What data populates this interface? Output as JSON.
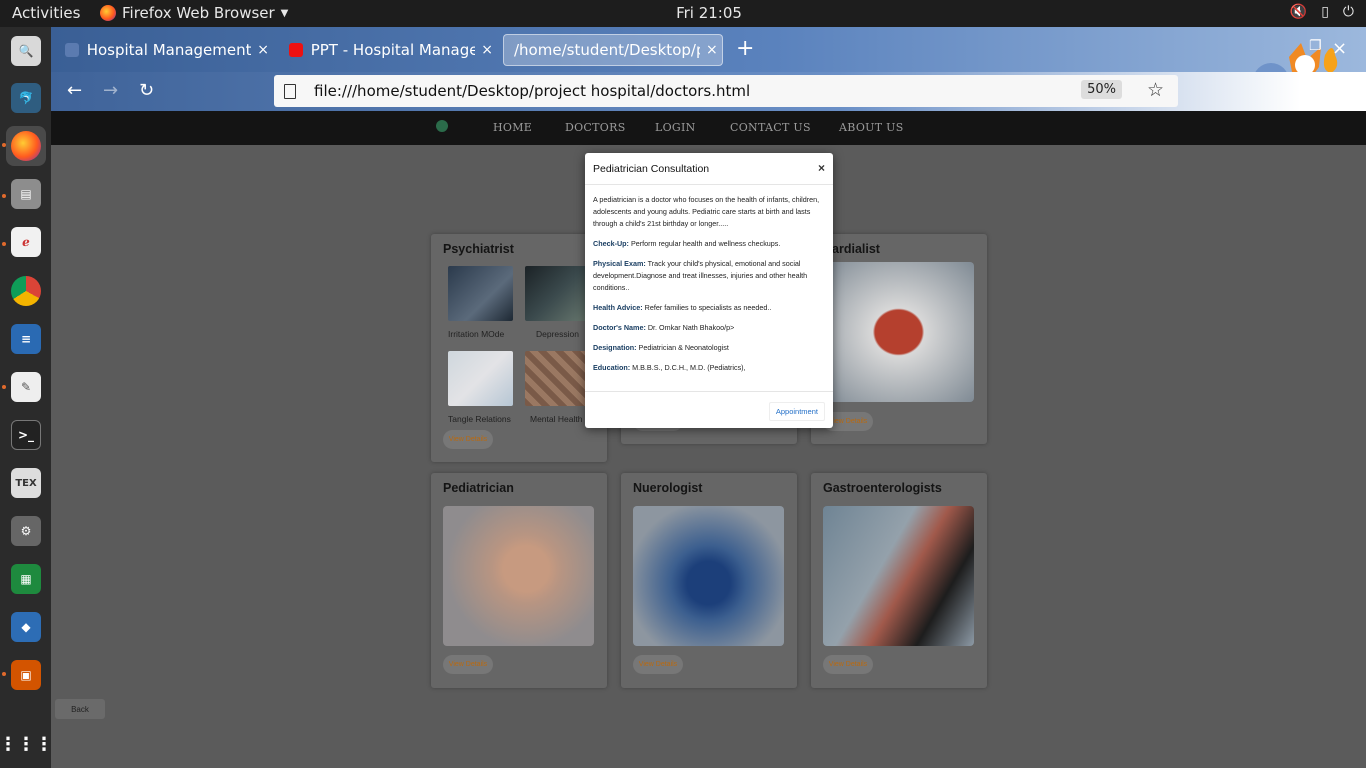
{
  "topbar": {
    "activities": "Activities",
    "app_name": "Firefox Web Browser",
    "clock": "Fri 21:05",
    "tray_icons": [
      "volume-muted-icon",
      "battery-icon",
      "power-icon"
    ]
  },
  "dock": {
    "items": [
      "magnifier-app-icon",
      "dbeaver-icon",
      "firefox-icon",
      "file-manager-icon",
      "editor-icon",
      "chrome-icon",
      "writer-icon",
      "text-editor-icon",
      "terminal-icon",
      "texmaker-icon",
      "settings-icon",
      "calc-icon",
      "virtualbox-icon",
      "impress-icon",
      "app-grid-icon"
    ]
  },
  "browser": {
    "tabs": [
      {
        "label": "Hospital Management Sy",
        "close": "×"
      },
      {
        "label": "PPT - Hospital Manageme",
        "close": "×"
      },
      {
        "label": "/home/student/Desktop/pro",
        "close": "×"
      }
    ],
    "new_tab": "+",
    "window_close": "×",
    "url": "file:///home/student/Desktop/project hospital/doctors.html",
    "zoom": "50%"
  },
  "site": {
    "nav": [
      "HOME",
      "DOCTORS",
      "LOGIN",
      "CONTACT US",
      "ABOUT US"
    ],
    "cards": {
      "psychiatrist": {
        "title": "Psychiatrist",
        "thumbs": [
          "Irritation MOde",
          "Depression",
          "Tangle Relations",
          "Mental Health"
        ],
        "view": "View Details"
      },
      "cardialist": {
        "title": "Cardialist",
        "view": "View Details"
      },
      "middle_top": {
        "view": "View Details"
      },
      "pediatrician": {
        "title": "Pediatrician",
        "view": "View Details"
      },
      "neurologist": {
        "title": "Nuerologist",
        "view": "View Details"
      },
      "gastro": {
        "title": "Gastroenterologists",
        "view": "View Details"
      }
    },
    "back": "Back"
  },
  "modal": {
    "title": "Pediatrician Consultation",
    "close": "×",
    "intro": "A pediatrician is a doctor who focuses on the health of infants, children, adolescents and young adults. Pediatric care starts at birth and lasts through a child's 21st birthday or longer.....",
    "items": [
      {
        "label": "Check-Up:",
        "text": " Perform regular health and wellness checkups."
      },
      {
        "label": "Physical Exam:",
        "text": " Track your child's physical, emotional and social development.Diagnose and treat illnesses, injuries and other health conditions.."
      },
      {
        "label": "Health Advice:",
        "text": " Refer families to specialists as needed.."
      },
      {
        "label": "Doctor's Name:",
        "text": " Dr. Omkar Nath Bhakoo/p>"
      },
      {
        "label": "Designation:",
        "text": " Pediatrician & Neonatologist"
      },
      {
        "label": "Education:",
        "text": " M.B.B.S., D.C.H., M.D. (Pediatrics),"
      }
    ],
    "button": "Appointment"
  }
}
